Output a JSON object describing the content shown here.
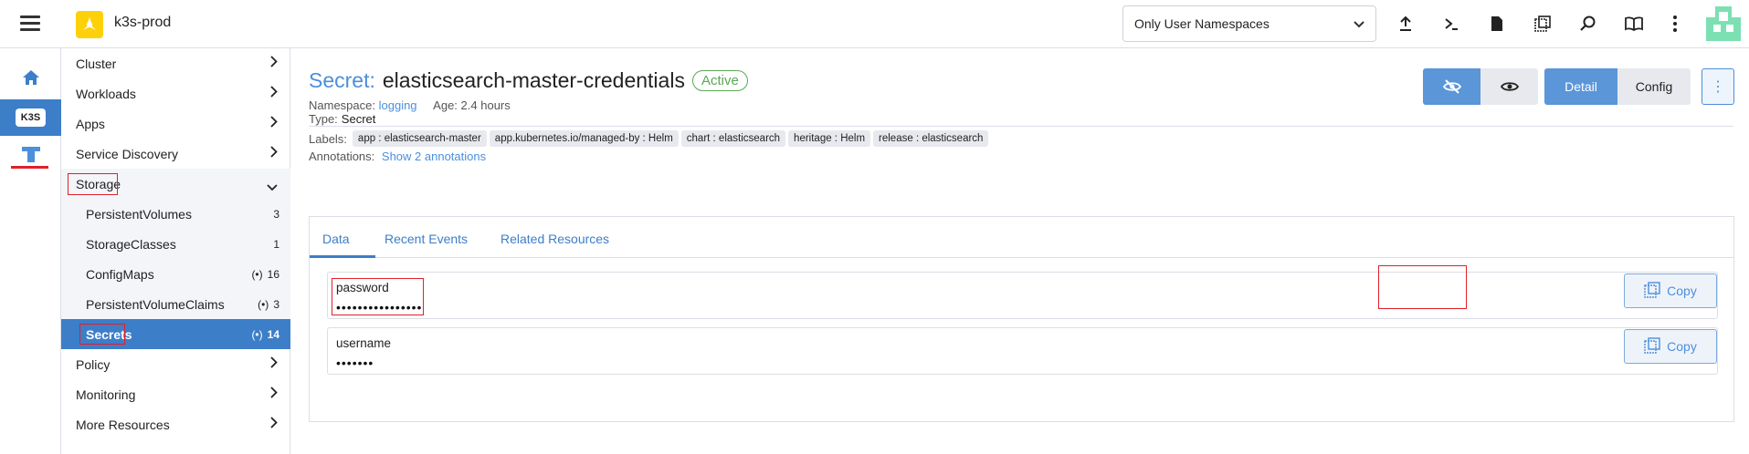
{
  "header": {
    "cluster_name": "k3s-prod",
    "namespace_filter": "Only User Namespaces",
    "icons": [
      "upload-icon",
      "terminal-icon",
      "file-icon",
      "copy-config-icon",
      "search-icon",
      "book-icon",
      "more-vertical-icon"
    ]
  },
  "rail": {
    "k3s_label": "K3S"
  },
  "sidebar": {
    "cluster": "Cluster",
    "workloads": "Workloads",
    "apps": "Apps",
    "service_discovery": "Service Discovery",
    "storage": "Storage",
    "storage_items": [
      {
        "label": "PersistentVolumes",
        "count": "3",
        "ns": false
      },
      {
        "label": "StorageClasses",
        "count": "1",
        "ns": false
      },
      {
        "label": "ConfigMaps",
        "count": "16",
        "ns": true
      },
      {
        "label": "PersistentVolumeClaims",
        "count": "3",
        "ns": true
      },
      {
        "label": "Secrets",
        "count": "14",
        "ns": true
      }
    ],
    "policy": "Policy",
    "monitoring": "Monitoring",
    "more_resources": "More Resources"
  },
  "resource": {
    "type": "Secret:",
    "name": "elasticsearch-master-credentials",
    "status": "Active",
    "namespace_label": "Namespace:",
    "namespace": "logging",
    "age_label": "Age:",
    "age": "2.4 hours",
    "detail": "Detail",
    "config": "Config"
  },
  "info": {
    "type_label": "Type:",
    "type_value": "Secret",
    "labels_label": "Labels:",
    "labels": [
      "app : elasticsearch-master",
      "app.kubernetes.io/managed-by : Helm",
      "chart : elasticsearch",
      "heritage : Helm",
      "release : elasticsearch"
    ],
    "annotations_label": "Annotations:",
    "annotations_link": "Show 2 annotations"
  },
  "tabs": [
    "Data",
    "Recent Events",
    "Related Resources"
  ],
  "data": [
    {
      "key": "password",
      "value": "••••••••••••••••",
      "copy": "Copy"
    },
    {
      "key": "username",
      "value": "•••••••",
      "copy": "Copy"
    }
  ],
  "colors": {
    "accent": "#3d7ec8",
    "active": "#5ba855",
    "highlight": "#e0202a"
  }
}
